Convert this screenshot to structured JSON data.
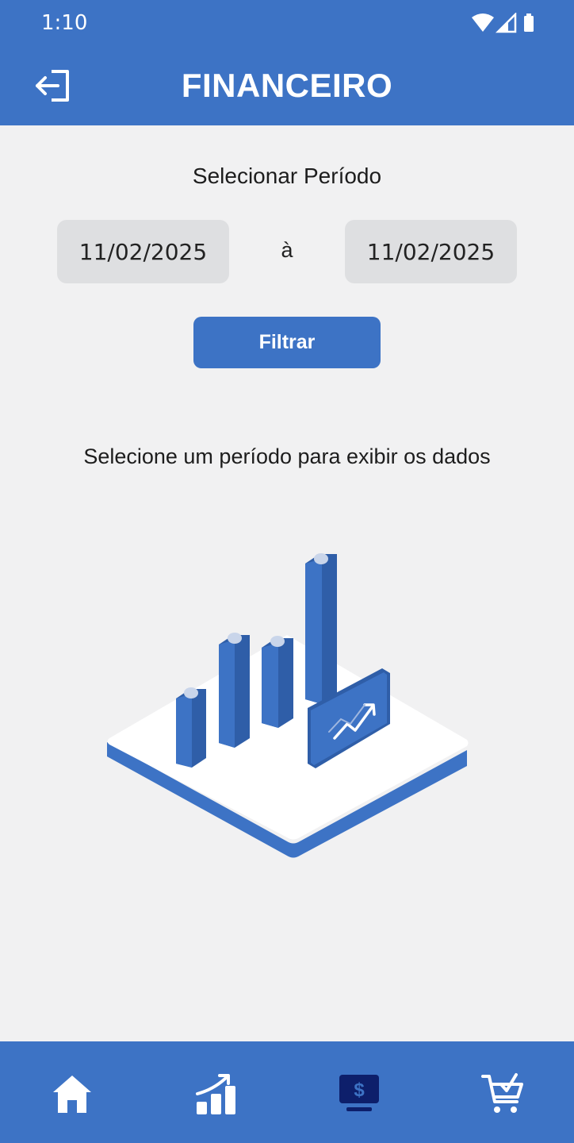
{
  "status_bar": {
    "time": "1:10"
  },
  "header": {
    "title": "FINANCEIRO",
    "back_icon": "logout-arrow-icon"
  },
  "period": {
    "label": "Selecionar Período",
    "from": "11/02/2025",
    "separator": "à",
    "to": "11/02/2025"
  },
  "filter_button": {
    "label": "Filtrar"
  },
  "empty_state": {
    "message": "Selecione um período para exibir os dados"
  },
  "bottom_nav": {
    "items": [
      {
        "icon": "home-icon",
        "active": false
      },
      {
        "icon": "chart-growth-icon",
        "active": false
      },
      {
        "icon": "monitor-dollar-icon",
        "active": true
      },
      {
        "icon": "cart-check-icon",
        "active": false
      }
    ]
  },
  "colors": {
    "primary": "#3d73c5",
    "active_nav": "#0d1f6b",
    "background": "#f1f1f2",
    "date_field": "#dedfe1"
  }
}
